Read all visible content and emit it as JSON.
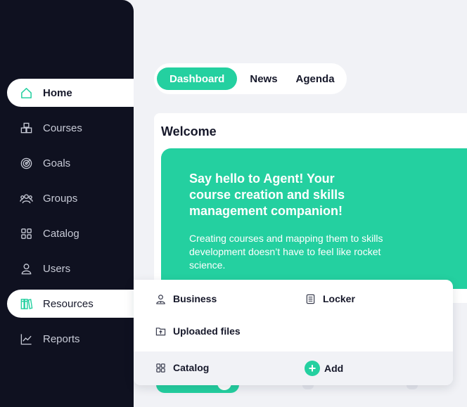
{
  "sidebar": {
    "items": [
      {
        "label": "Home",
        "icon": "home-icon"
      },
      {
        "label": "Courses",
        "icon": "cubes-icon"
      },
      {
        "label": "Goals",
        "icon": "target-icon"
      },
      {
        "label": "Groups",
        "icon": "users-group-icon"
      },
      {
        "label": "Catalog",
        "icon": "grid-icon"
      },
      {
        "label": "Users",
        "icon": "user-icon"
      },
      {
        "label": "Resources",
        "icon": "books-icon"
      },
      {
        "label": "Reports",
        "icon": "line-chart-icon"
      }
    ],
    "active_item": "Home",
    "highlighted_item": "Resources"
  },
  "tabs": [
    {
      "label": "Dashboard",
      "active": true
    },
    {
      "label": "News",
      "active": false
    },
    {
      "label": "Agenda",
      "active": false
    }
  ],
  "welcome": {
    "title": "Welcome",
    "hero_title": "Say hello to Agent! Your course creation and skills management companion!",
    "hero_text": "Creating courses and mapping them to skills development doesn’t have to feel like rocket science."
  },
  "resources_menu": {
    "items": [
      {
        "label": "Business",
        "icon": "business-icon"
      },
      {
        "label": "Locker",
        "icon": "locker-icon"
      },
      {
        "label": "Uploaded files",
        "icon": "upload-folder-icon"
      }
    ],
    "footer": {
      "catalog_label": "Catalog",
      "add_label": "Add",
      "add_symbol": "+"
    }
  },
  "colors": {
    "accent": "#24d0a0",
    "sidebar_bg": "#0f1120",
    "page_bg": "#f1f2f6"
  }
}
